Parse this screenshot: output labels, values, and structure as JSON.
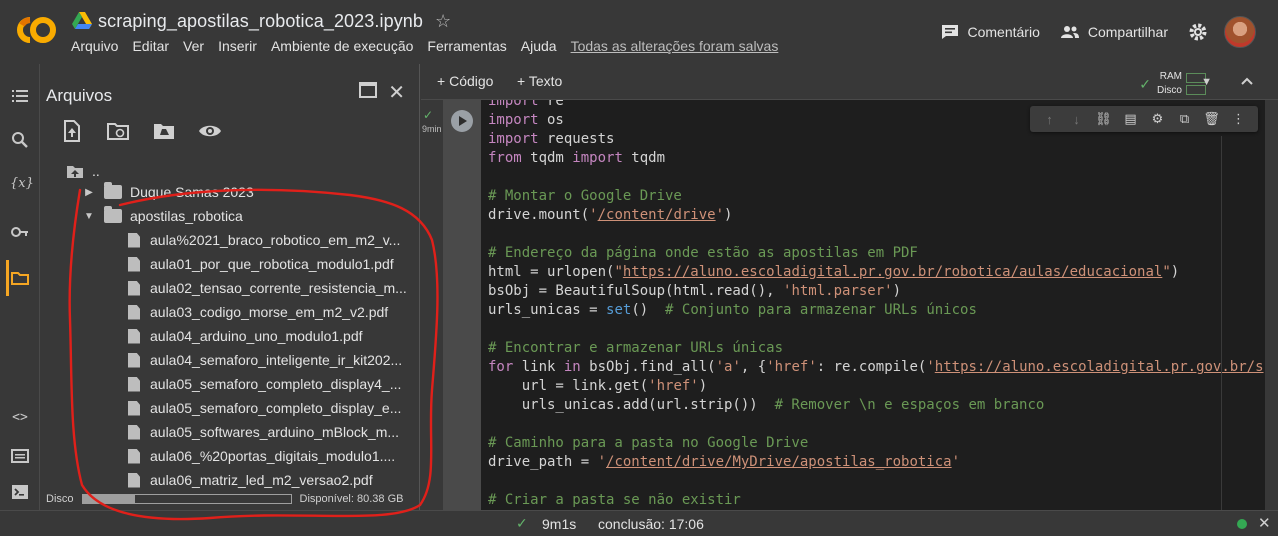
{
  "header": {
    "notebook_title": "scraping_apostilas_robotica_2023.ipynb",
    "menu": [
      "Arquivo",
      "Editar",
      "Ver",
      "Inserir",
      "Ambiente de execução",
      "Ferramentas",
      "Ajuda"
    ],
    "save_status": "Todas as alterações foram salvas",
    "comment_label": "Comentário",
    "share_label": "Compartilhar"
  },
  "files_panel": {
    "title": "Arquivos",
    "parent": "..",
    "folders": [
      {
        "name": "Duque Samas 2023",
        "expanded": false
      },
      {
        "name": "apostilas_robotica",
        "expanded": true
      }
    ],
    "files": [
      "aula%2021_braco_robotico_em_m2_v...",
      "aula01_por_que_robotica_modulo1.pdf",
      "aula02_tensao_corrente_resistencia_m...",
      "aula03_codigo_morse_em_m2_v2.pdf",
      "aula04_arduino_uno_modulo1.pdf",
      "aula04_semaforo_inteligente_ir_kit202...",
      "aula05_semaforo_completo_display4_...",
      "aula05_semaforo_completo_display_e...",
      "aula05_softwares_arduino_mBlock_m...",
      "aula06_%20portas_digitais_modulo1....",
      "aula06_matriz_led_m2_versao2.pdf"
    ],
    "disk_label": "Disco",
    "disk_used_fraction": 0.25,
    "disk_available": "Disponível: 80.38 GB"
  },
  "editor": {
    "add_code": "Código",
    "add_text": "Texto",
    "ram_label": "RAM",
    "disk_label": "Disco",
    "cell_exec_time": "9min"
  },
  "status": {
    "exec_time": "9m1s",
    "completion": "conclusão: 17:06"
  },
  "colors": {
    "background": "#383838",
    "code_bg": "#1e1e1e",
    "accent": "#f5a623",
    "success": "#34a853",
    "annotation": "#e0201a"
  }
}
